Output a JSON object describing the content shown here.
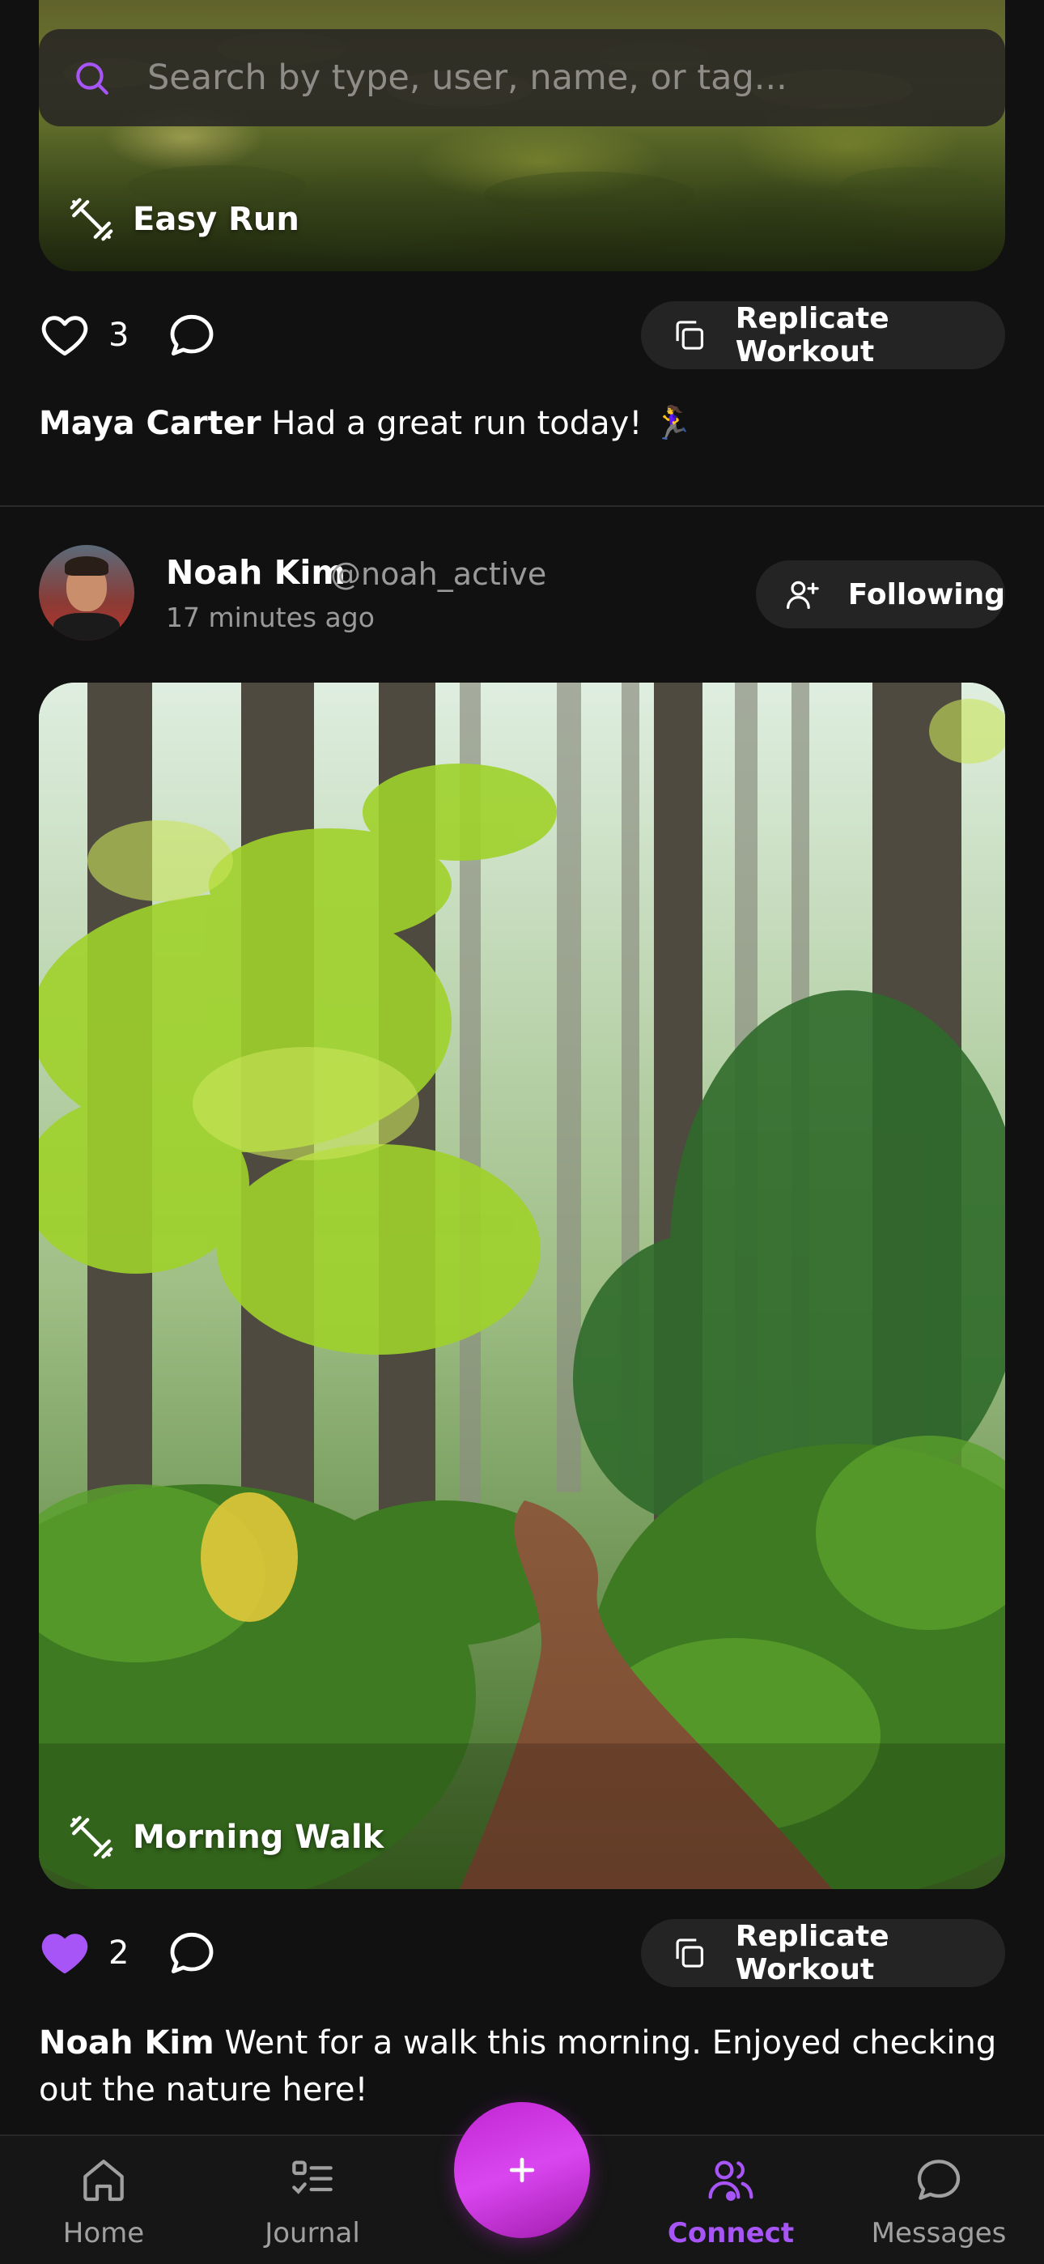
{
  "search": {
    "placeholder": "Search by type, user, name, or tag..."
  },
  "colors": {
    "accent": "#a855f7",
    "fab": "#d946ef",
    "background": "#111112",
    "card": "#242424"
  },
  "posts": [
    {
      "workout_tag": "Easy Run",
      "likes": "3",
      "liked": false,
      "replicate_label": "Replicate Workout",
      "caption_author": "Maya Carter",
      "caption_text": "Had a great run today! 🏃‍♀️"
    },
    {
      "user_name": "Noah Kim",
      "handle": "@noah_active",
      "time_ago": "17 minutes ago",
      "follow_label": "Following",
      "workout_tag": "Morning Walk",
      "likes": "2",
      "liked": true,
      "replicate_label": "Replicate Workout",
      "caption_author": "Noah Kim",
      "caption_text": "Went for a walk this morning. Enjoyed checking out the nature here!"
    }
  ],
  "icons": {
    "search": "search-icon",
    "workout": "dumbbell-icon",
    "like": "heart-icon",
    "comment": "comment-icon",
    "replicate": "copy-icon",
    "follow": "user-plus-icon",
    "create": "plus-icon"
  },
  "nav": {
    "items": [
      {
        "label": "Home",
        "icon": "home-icon"
      },
      {
        "label": "Journal",
        "icon": "journal-icon"
      },
      {
        "label": "Connect",
        "icon": "users-icon",
        "active": true
      },
      {
        "label": "Messages",
        "icon": "message-icon"
      }
    ]
  }
}
